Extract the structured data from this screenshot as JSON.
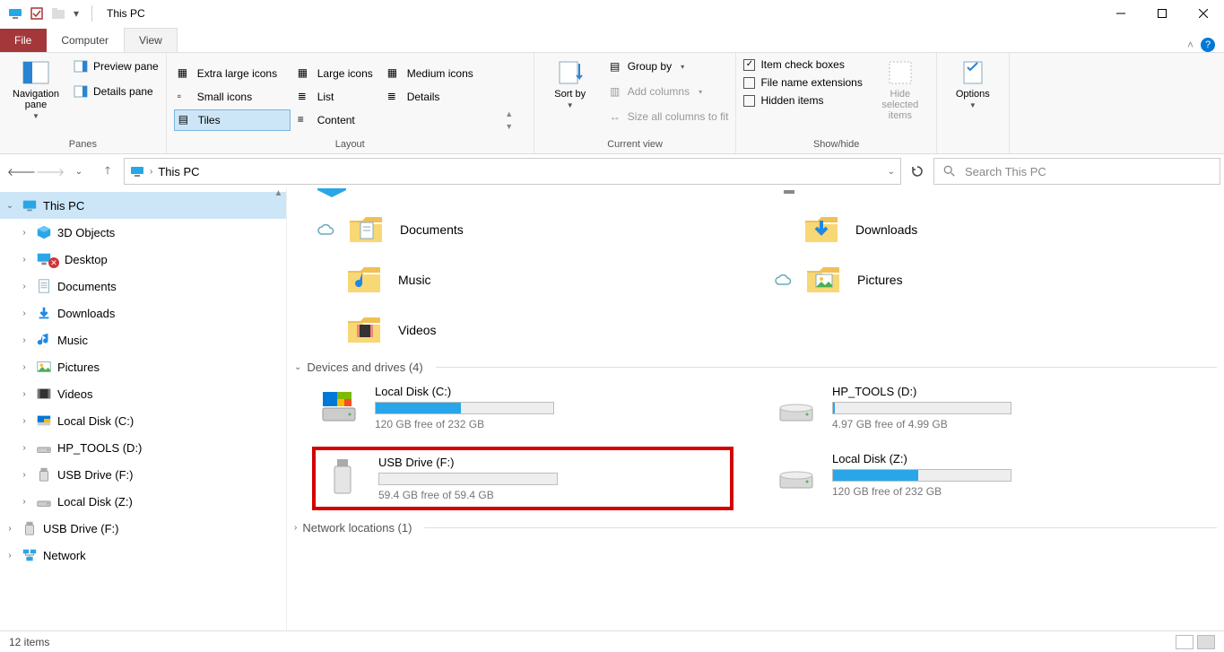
{
  "window": {
    "title": "This PC"
  },
  "tabs": {
    "file": "File",
    "computer": "Computer",
    "view": "View"
  },
  "ribbon": {
    "panes": {
      "label": "Panes",
      "navigation": "Navigation pane",
      "preview": "Preview pane",
      "details": "Details pane"
    },
    "layout": {
      "label": "Layout",
      "extra_large": "Extra large icons",
      "large": "Large icons",
      "medium": "Medium icons",
      "small": "Small icons",
      "list": "List",
      "details": "Details",
      "tiles": "Tiles",
      "content": "Content"
    },
    "current_view": {
      "label": "Current view",
      "sort_by": "Sort by",
      "group_by": "Group by",
      "add_columns": "Add columns",
      "size_all": "Size all columns to fit"
    },
    "show_hide": {
      "label": "Show/hide",
      "item_check": "Item check boxes",
      "file_ext": "File name extensions",
      "hidden": "Hidden items",
      "hide_selected": "Hide selected items"
    },
    "options": {
      "label": "Options"
    }
  },
  "address": {
    "location": "This PC"
  },
  "search": {
    "placeholder": "Search This PC"
  },
  "nav": {
    "this_pc": "This PC",
    "items": [
      {
        "label": "3D Objects",
        "icon": "cube"
      },
      {
        "label": "Desktop",
        "icon": "desktop",
        "error": true
      },
      {
        "label": "Documents",
        "icon": "doc"
      },
      {
        "label": "Downloads",
        "icon": "download"
      },
      {
        "label": "Music",
        "icon": "music"
      },
      {
        "label": "Pictures",
        "icon": "picture"
      },
      {
        "label": "Videos",
        "icon": "video"
      },
      {
        "label": "Local Disk (C:)",
        "icon": "disk-c"
      },
      {
        "label": "HP_TOOLS (D:)",
        "icon": "drive"
      },
      {
        "label": "USB Drive (F:)",
        "icon": "usb"
      },
      {
        "label": "Local Disk (Z:)",
        "icon": "drive"
      }
    ],
    "usb_outer": "USB Drive (F:)",
    "network": "Network"
  },
  "folders": [
    {
      "name": "Documents",
      "icon": "doc",
      "cloud": true
    },
    {
      "name": "Downloads",
      "icon": "download"
    },
    {
      "name": "Music",
      "icon": "music"
    },
    {
      "name": "Pictures",
      "icon": "picture",
      "cloud": true
    },
    {
      "name": "Videos",
      "icon": "video"
    }
  ],
  "devices_header": "Devices and drives (4)",
  "drives": [
    {
      "name": "Local Disk (C:)",
      "sub": "120 GB free of 232 GB",
      "fill": 48,
      "icon": "disk-c"
    },
    {
      "name": "HP_TOOLS (D:)",
      "sub": "4.97 GB free of 4.99 GB",
      "fill": 1,
      "icon": "drive"
    },
    {
      "name": "USB Drive (F:)",
      "sub": "59.4 GB free of 59.4 GB",
      "fill": 0,
      "icon": "usb",
      "highlight": true
    },
    {
      "name": "Local Disk (Z:)",
      "sub": "120 GB free of 232 GB",
      "fill": 48,
      "icon": "drive"
    }
  ],
  "network_header": "Network locations (1)",
  "status": {
    "count": "12 items"
  }
}
